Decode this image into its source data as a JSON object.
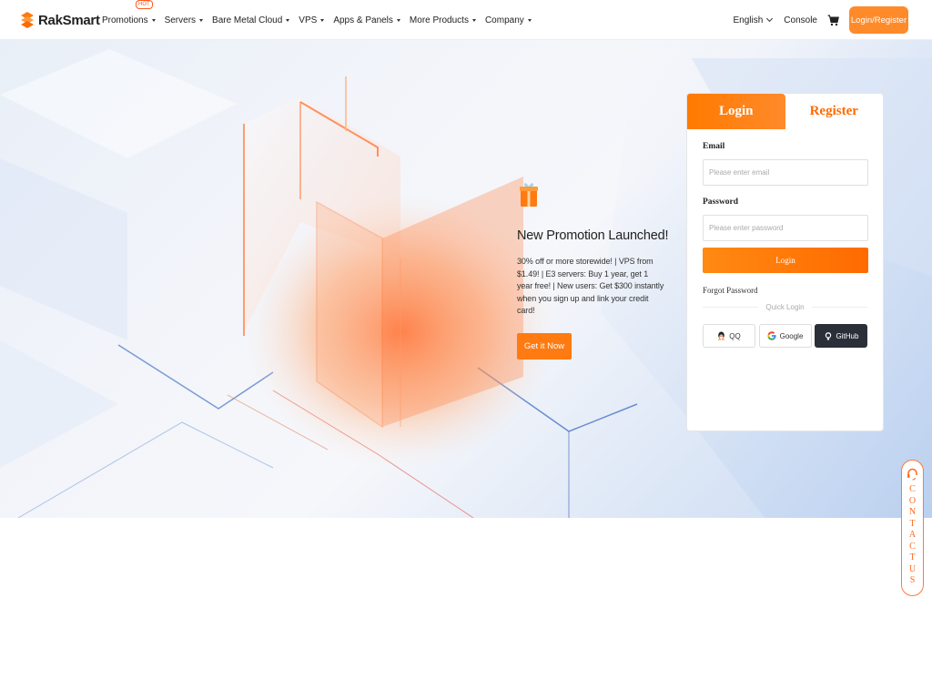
{
  "brand": {
    "name": "RakSmart",
    "color": "#ff7a10"
  },
  "nav": {
    "items": [
      {
        "label": "Promotions",
        "badge": "HOT"
      },
      {
        "label": "Servers"
      },
      {
        "label": "Bare Metal Cloud"
      },
      {
        "label": "VPS"
      },
      {
        "label": "Apps & Panels"
      },
      {
        "label": "More Products"
      },
      {
        "label": "Company"
      }
    ],
    "language": "English",
    "console": "Console",
    "cart_icon": "cart-icon",
    "login_register": "Login/Register"
  },
  "promo": {
    "icon": "gift-icon",
    "title": "New Promotion Launched!",
    "description": "30% off or more storewide! | VPS from $1.49! | E3 servers: Buy 1 year, get 1 year free! | New users: Get $300 instantly when you sign up and link your credit card!",
    "button": "Get it Now"
  },
  "login_card": {
    "tabs": {
      "login": "Login",
      "register": "Register"
    },
    "email_label": "Email",
    "email_placeholder": "Please enter email",
    "password_label": "Password",
    "password_placeholder": "Please enter password",
    "submit": "Login",
    "forgot": "Forgot Password",
    "quick_login": "Quick Login",
    "socials": {
      "qq": "QQ",
      "google": "Google",
      "github": "GitHub"
    }
  },
  "contact": {
    "label": "CONTACTUS",
    "icon": "headset-icon"
  }
}
